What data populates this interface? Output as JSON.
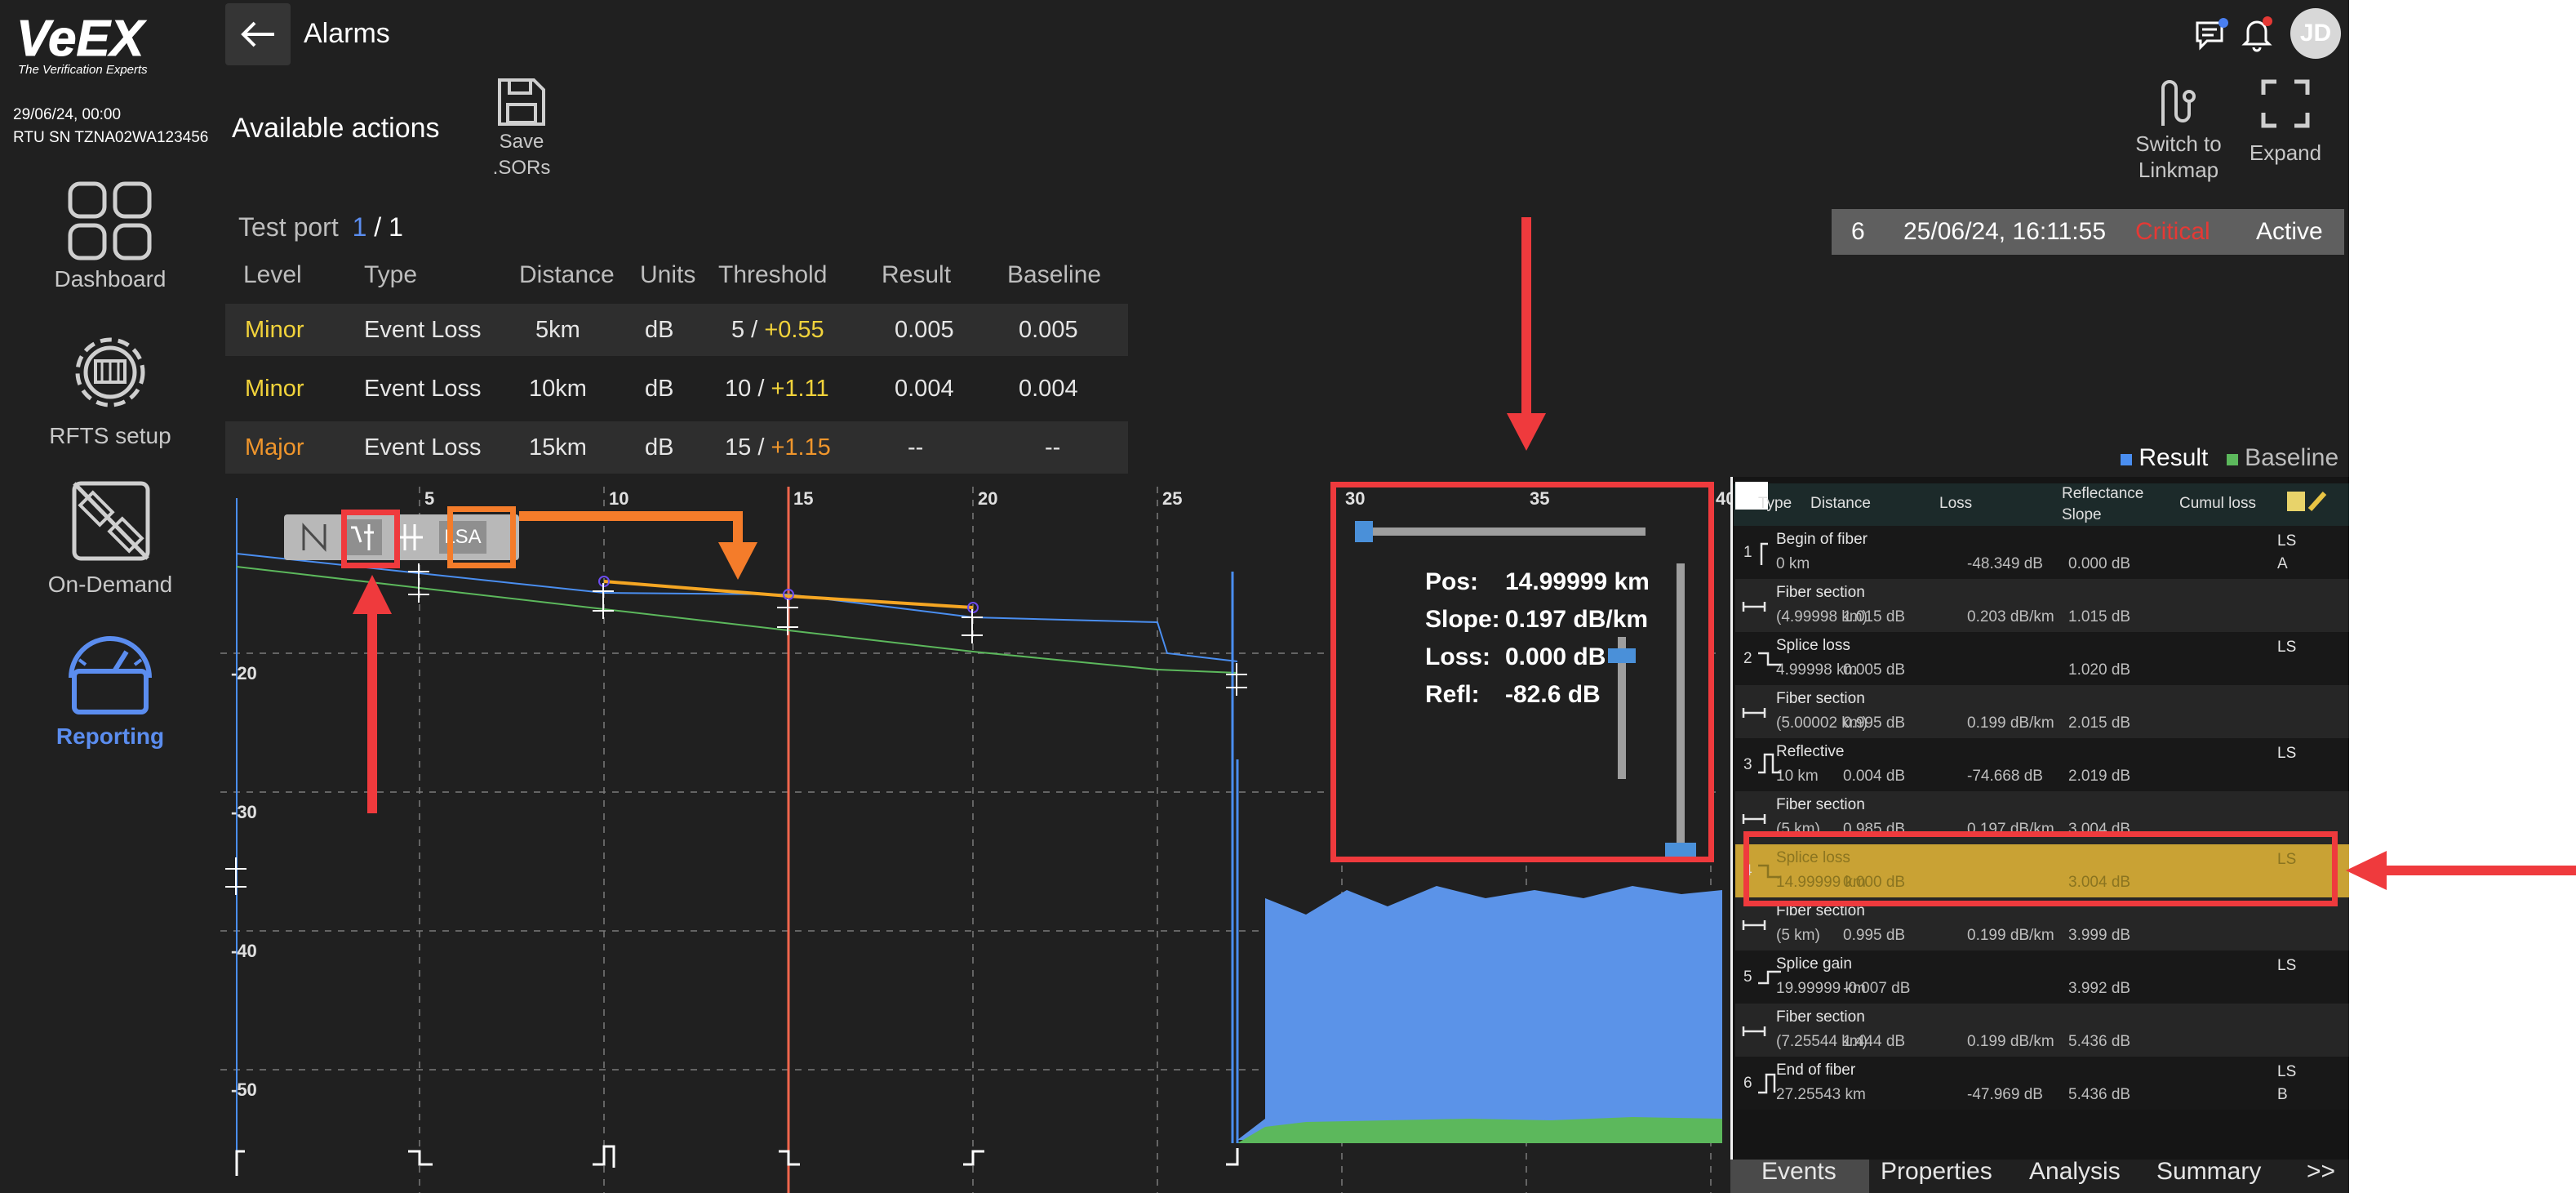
{
  "header": {
    "title": "Alarms",
    "back_icon": "arrow-left-icon"
  },
  "device": {
    "datetime": "29/06/24, 00:00",
    "rtu": "RTU SN TZNA02WA123456",
    "avatar": "JD",
    "logo_text": "VeEX",
    "logo_tagline": "The Verification Experts"
  },
  "sidebar": {
    "items": [
      {
        "label": "Dashboard",
        "icon": "dashboard-icon",
        "active": false
      },
      {
        "label": "RFTS setup",
        "icon": "gear-icon",
        "active": false
      },
      {
        "label": "On-Demand",
        "icon": "on-demand-icon",
        "active": false
      },
      {
        "label": "Reporting",
        "icon": "gauge-icon",
        "active": true
      }
    ]
  },
  "actions": {
    "title": "Available actions",
    "save_label_1": "Save",
    "save_label_2": ".SORs",
    "switch_label_1": "Switch to",
    "switch_label_2": "Linkmap",
    "expand_label": "Expand"
  },
  "testport": {
    "label": "Test port",
    "current": "1",
    "sep": "/",
    "total": "1"
  },
  "alarm_table": {
    "headers": [
      "Level",
      "Type",
      "Distance",
      "Units",
      "Threshold",
      "Result",
      "Baseline"
    ],
    "rows": [
      {
        "level": "Minor",
        "type": "Event Loss",
        "distance": "5km",
        "units": "dB",
        "thr_a": "5 / ",
        "thr_b": "+0.55",
        "result": "0.005",
        "baseline": "0.005"
      },
      {
        "level": "Minor",
        "type": "Event Loss",
        "distance": "10km",
        "units": "dB",
        "thr_a": "10 / ",
        "thr_b": "+1.11",
        "result": "0.004",
        "baseline": "0.004"
      },
      {
        "level": "Major",
        "type": "Event Loss",
        "distance": "15km",
        "units": "dB",
        "thr_a": "15 / ",
        "thr_b": "+1.15",
        "result": "--",
        "baseline": "--"
      }
    ]
  },
  "status_bar": {
    "id": "6",
    "datetime": "25/06/24, 16:11:55",
    "severity": "Critical",
    "state": "Active"
  },
  "legend": {
    "result": "Result",
    "baseline": "Baseline",
    "result_color": "#4a8ef0",
    "baseline_color": "#5cb85c"
  },
  "chart_toolbar": {
    "lsa": "LSA"
  },
  "chart": {
    "x_ticks": [
      "5",
      "10",
      "15",
      "20",
      "25",
      "30",
      "35",
      "40"
    ],
    "y_ticks": [
      "-20",
      "-30",
      "-40",
      "-50"
    ]
  },
  "cursor_info": {
    "pos_label": "Pos:",
    "pos_value": "14.99999 km",
    "slope_label": "Slope:",
    "slope_value": "0.197 dB/km",
    "loss_label": "Loss:",
    "loss_value": "0.000 dB",
    "refl_label": "Refl:",
    "refl_value": "-82.6 dB"
  },
  "events_table": {
    "headers": {
      "type": "Type",
      "distance": "Distance",
      "loss": "Loss",
      "refl_1": "Reflectance",
      "refl_2": "Slope",
      "cumul": "Cumul loss"
    },
    "rows": [
      {
        "num": "1",
        "name": "Begin of fiber",
        "dist": "0 km",
        "loss": "",
        "refl": "-48.349 dB",
        "cumul": "0.000 dB",
        "flag1": "LS",
        "flag2": "A",
        "kind": "begin"
      },
      {
        "num": "",
        "name": "Fiber section",
        "dist": "(4.99998 km)",
        "loss": "1.015 dB",
        "refl": "0.203 dB/km",
        "cumul": "1.015 dB",
        "flag1": "",
        "flag2": "",
        "kind": "section"
      },
      {
        "num": "2",
        "name": "Splice loss",
        "dist": "4.99998 km",
        "loss": "0.005 dB",
        "refl": "",
        "cumul": "1.020 dB",
        "flag1": "LS",
        "flag2": "",
        "kind": "splice"
      },
      {
        "num": "",
        "name": "Fiber section",
        "dist": "(5.00002 km)",
        "loss": "0.995 dB",
        "refl": "0.199 dB/km",
        "cumul": "2.015 dB",
        "flag1": "",
        "flag2": "",
        "kind": "section"
      },
      {
        "num": "3",
        "name": "Reflective",
        "dist": "10 km",
        "loss": "0.004 dB",
        "refl": "-74.668 dB",
        "cumul": "2.019 dB",
        "flag1": "LS",
        "flag2": "",
        "kind": "reflective"
      },
      {
        "num": "",
        "name": "Fiber section",
        "dist": "(5 km)",
        "loss": "0.985 dB",
        "refl": "0.197 dB/km",
        "cumul": "3.004 dB",
        "flag1": "",
        "flag2": "",
        "kind": "section"
      },
      {
        "num": "4",
        "name": "Splice loss",
        "dist": "14.99999 km",
        "loss": "0.000 dB",
        "refl": "",
        "cumul": "3.004 dB",
        "flag1": "LS",
        "flag2": "",
        "kind": "splice"
      },
      {
        "num": "",
        "name": "Fiber section",
        "dist": "(5 km)",
        "loss": "0.995 dB",
        "refl": "0.199 dB/km",
        "cumul": "3.999 dB",
        "flag1": "",
        "flag2": "",
        "kind": "section"
      },
      {
        "num": "5",
        "name": "Splice gain",
        "dist": "19.99999 km",
        "loss": "-0.007 dB",
        "refl": "",
        "cumul": "3.992 dB",
        "flag1": "LS",
        "flag2": "",
        "kind": "gain"
      },
      {
        "num": "",
        "name": "Fiber section",
        "dist": "(7.25544 km)",
        "loss": "1.444 dB",
        "refl": "0.199 dB/km",
        "cumul": "5.436 dB",
        "flag1": "",
        "flag2": "",
        "kind": "section"
      },
      {
        "num": "6",
        "name": "End of fiber",
        "dist": "27.25543 km",
        "loss": "",
        "refl": "-47.969 dB",
        "cumul": "5.436 dB",
        "flag1": "LS",
        "flag2": "B",
        "kind": "end"
      }
    ]
  },
  "bottom_tabs": [
    "Events",
    "Properties",
    "Analysis",
    "Summary",
    ">>"
  ],
  "colors": {
    "minor": "#f2d33b",
    "major": "#f0962c",
    "critical": "#e53935",
    "accent": "#5b8def",
    "highlight": "#c9a234",
    "annotation_red": "#ef3a3d",
    "annotation_orange": "#f47c2a"
  }
}
